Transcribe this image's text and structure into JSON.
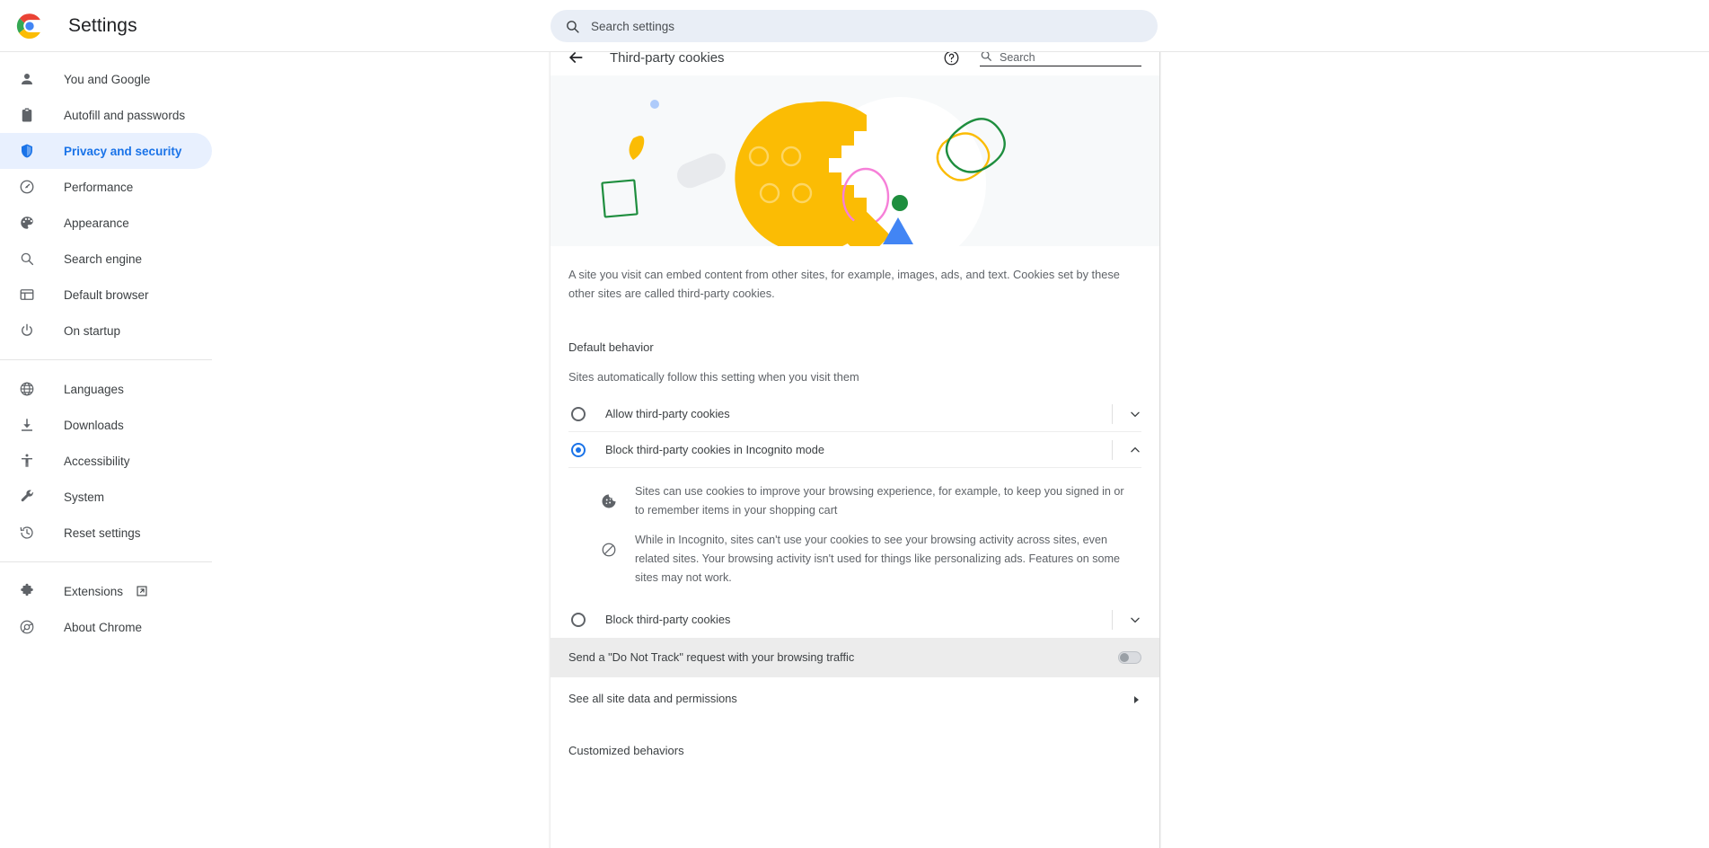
{
  "app": {
    "title": "Settings",
    "logo_icon": "chrome-logo-icon"
  },
  "search": {
    "placeholder": "Search settings",
    "value": "",
    "icon": "search-icon"
  },
  "sidebar": {
    "groups": [
      {
        "items": [
          {
            "label": "You and Google",
            "icon": "person-icon",
            "selected": false
          },
          {
            "label": "Autofill and passwords",
            "icon": "clipboard-icon",
            "selected": false
          },
          {
            "label": "Privacy and security",
            "icon": "shield-icon",
            "selected": true
          },
          {
            "label": "Performance",
            "icon": "speedometer-icon",
            "selected": false
          },
          {
            "label": "Appearance",
            "icon": "palette-icon",
            "selected": false
          },
          {
            "label": "Search engine",
            "icon": "search-icon",
            "selected": false
          },
          {
            "label": "Default browser",
            "icon": "browser-window-icon",
            "selected": false
          },
          {
            "label": "On startup",
            "icon": "power-icon",
            "selected": false
          }
        ]
      },
      {
        "items": [
          {
            "label": "Languages",
            "icon": "globe-icon",
            "selected": false
          },
          {
            "label": "Downloads",
            "icon": "download-icon",
            "selected": false
          },
          {
            "label": "Accessibility",
            "icon": "accessibility-icon",
            "selected": false
          },
          {
            "label": "System",
            "icon": "wrench-icon",
            "selected": false
          },
          {
            "label": "Reset settings",
            "icon": "history-icon",
            "selected": false
          }
        ]
      },
      {
        "items": [
          {
            "label": "Extensions",
            "icon": "puzzle-icon",
            "external": true,
            "external_icon": "external-link-icon",
            "selected": false
          },
          {
            "label": "About Chrome",
            "icon": "chrome-outline-icon",
            "selected": false
          }
        ]
      }
    ]
  },
  "page": {
    "back_icon": "back-arrow-icon",
    "title": "Third-party cookies",
    "help_icon": "help-circle-icon",
    "search_icon": "search-icon",
    "search_placeholder": "Search",
    "search_value": "",
    "illustration": {
      "name": "third-party-cookies-illustration",
      "cookie_color": "#fbbc04",
      "accents": [
        "#1a73e8",
        "#34a853",
        "#ea4ec4",
        "#fbbc04",
        "#e8eaed"
      ]
    },
    "blurb": "A site you visit can embed content from other sites, for example, images, ads, and text. Cookies set by these other sites are called third-party cookies.",
    "default_behavior": {
      "title": "Default behavior",
      "subtitle": "Sites automatically follow this setting when you visit them",
      "options": [
        {
          "label": "Allow third-party cookies",
          "selected": false,
          "expanded": false,
          "chevron_icon": "chevron-down-icon"
        },
        {
          "label": "Block third-party cookies in Incognito mode",
          "selected": true,
          "expanded": true,
          "chevron_icon": "chevron-up-icon",
          "details": [
            {
              "icon": "cookie-icon",
              "text": "Sites can use cookies to improve your browsing experience, for example, to keep you signed in or to remember items in your shopping cart"
            },
            {
              "icon": "block-icon",
              "text": "While in Incognito, sites can't use your cookies to see your browsing activity across sites, even related sites. Your browsing activity isn't used for things like personalizing ads. Features on some sites may not work."
            }
          ]
        },
        {
          "label": "Block third-party cookies",
          "selected": false,
          "expanded": false,
          "chevron_icon": "chevron-down-icon"
        }
      ]
    },
    "do_not_track": {
      "label": "Send a \"Do Not Track\" request with your browsing traffic",
      "toggle_on": false,
      "toggle_icon": "toggle-switch-off"
    },
    "site_data_link": {
      "label": "See all site data and permissions",
      "arrow_icon": "chevron-right-icon"
    },
    "customized_behaviors": {
      "title": "Customized behaviors"
    }
  },
  "colors": {
    "accent": "#1a73e8",
    "accent_bg": "#e8f0fe",
    "text_primary": "#3c4043",
    "text_secondary": "#5f6368",
    "hero_bg": "#f7f9fa",
    "highlight_row": "#ececec"
  }
}
